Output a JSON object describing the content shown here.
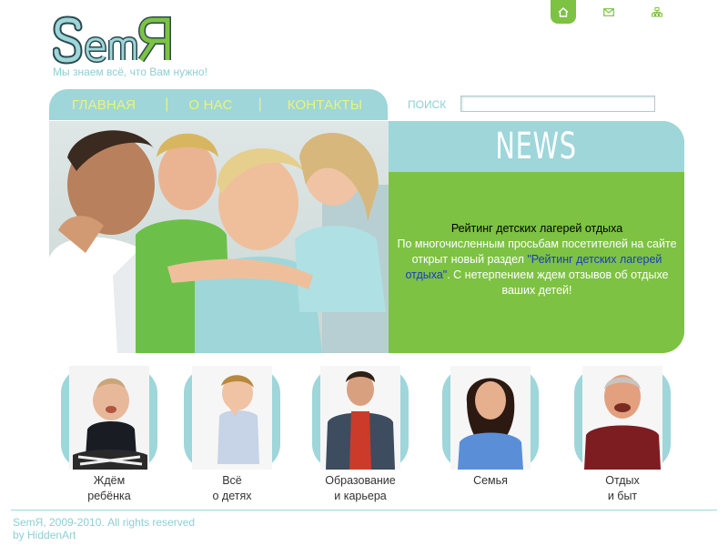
{
  "header": {
    "logo_text": "SemЯ",
    "tagline": "Мы знаем всё, что Вам нужно!",
    "icons": [
      "home-icon",
      "mail-icon",
      "sitemap-icon"
    ]
  },
  "nav": {
    "items": [
      "ГЛАВНАЯ",
      "О НАС",
      "КОНТАКТЫ"
    ],
    "separator": "|"
  },
  "search": {
    "label": "ПОИСК",
    "value": "",
    "placeholder": ""
  },
  "news": {
    "title": "NEWS",
    "headline": "Рейтинг детских лагерей отдыха",
    "text_before": "По многочисленным просьбам посетителей на сайте открыт новый раздел ",
    "link_text": "\"Рейтинг детских лагерей отдыха\"",
    "text_after": ". С нетерпением ждем отзывов об отдыхе ваших детей!"
  },
  "categories": [
    {
      "line1": "Ждём",
      "line2": "ребёнка"
    },
    {
      "line1": "Всё",
      "line2": "о детях"
    },
    {
      "line1": "Образование",
      "line2": "и карьера"
    },
    {
      "line1": "Семья",
      "line2": ""
    },
    {
      "line1": "Отдых",
      "line2": "и быт"
    }
  ],
  "footer": {
    "copyright": "SemЯ, 2009-2010. All rights reserved",
    "credit": "by HiddenArt"
  },
  "colors": {
    "accent_green": "#7dc243",
    "accent_teal": "#9ed6da",
    "nav_text": "#e9f47a",
    "link_blue": "#1a3bc4"
  }
}
